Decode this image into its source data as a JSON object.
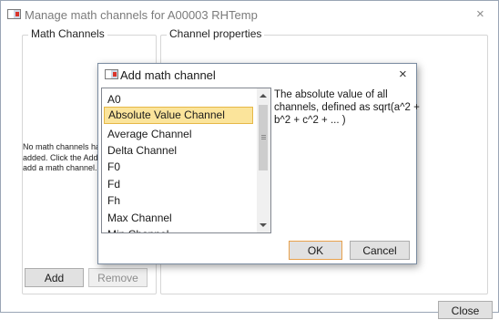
{
  "window": {
    "title": "Manage math channels for A00003 RHTemp",
    "close_glyph": "×",
    "icon": "app-window-icon"
  },
  "math_channels_group": {
    "label": "Math Channels",
    "empty_message_lines": [
      "No math channels ha",
      "added. Click the Add",
      "add a math channel."
    ],
    "add_label": "Add",
    "remove_label": "Remove"
  },
  "channel_properties_group": {
    "label": "Channel properties"
  },
  "footer": {
    "close_label": "Close"
  },
  "dialog": {
    "title": "Add math channel",
    "close_glyph": "×",
    "icon": "app-window-icon",
    "items": [
      "A0",
      "Absolute Value Channel",
      "Average Channel",
      "Delta Channel",
      "F0",
      "Fd",
      "Fh",
      "Max Channel",
      "Min Channel"
    ],
    "selected_item": "Absolute Value Channel",
    "description_lines": [
      "The absolute value of all",
      "channels, defined as sqrt(a^2 +",
      "b^2 + c^2 + ... )"
    ],
    "ok_label": "OK",
    "cancel_label": "Cancel"
  },
  "colors": {
    "selection_fill": "#fbe49b",
    "selection_border": "#e6b847",
    "focus_border": "#e8a14c"
  }
}
